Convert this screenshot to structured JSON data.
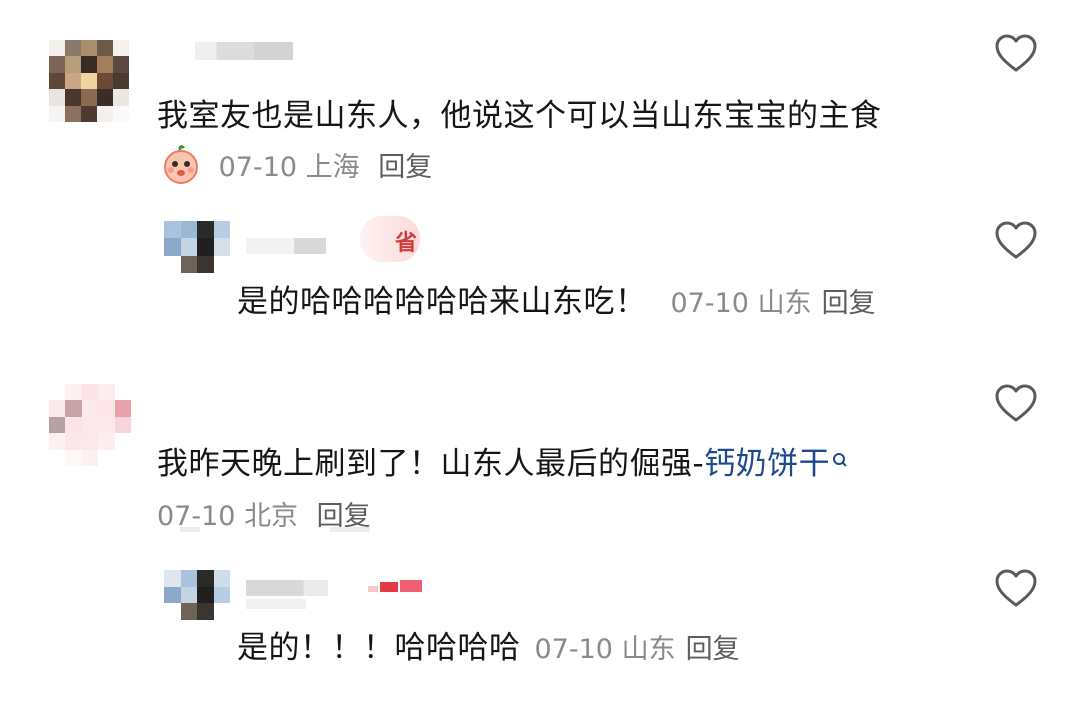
{
  "comments": [
    {
      "text": "我室友也是山东人，他说这个可以当山东宝宝的主食",
      "date": "07-10",
      "location": "上海",
      "reply_label": "回复",
      "like_icon": "heart-outline-icon",
      "emoji_icon": "peach-face-icon"
    },
    {
      "text": "是的哈哈哈哈哈哈来山东吃！",
      "date": "07-10",
      "location": "山东",
      "reply_label": "回复",
      "like_icon": "heart-outline-icon",
      "badge_text": "省"
    },
    {
      "text_prefix": "我昨天晚上刷到了！山东人最后的倔强-",
      "search_link": "钙奶饼干",
      "search_icon": "search-icon",
      "date": "07-10",
      "location": "北京",
      "reply_label": "回复",
      "like_icon": "heart-outline-icon"
    },
    {
      "text": "是的！！！哈哈哈哈",
      "date": "07-10",
      "location": "山东",
      "reply_label": "回复",
      "like_icon": "heart-outline-icon"
    }
  ],
  "colors": {
    "text": "#161616",
    "meta": "#8a8a8a",
    "link": "#1d4a8c",
    "heart": "#5a5a5a"
  }
}
